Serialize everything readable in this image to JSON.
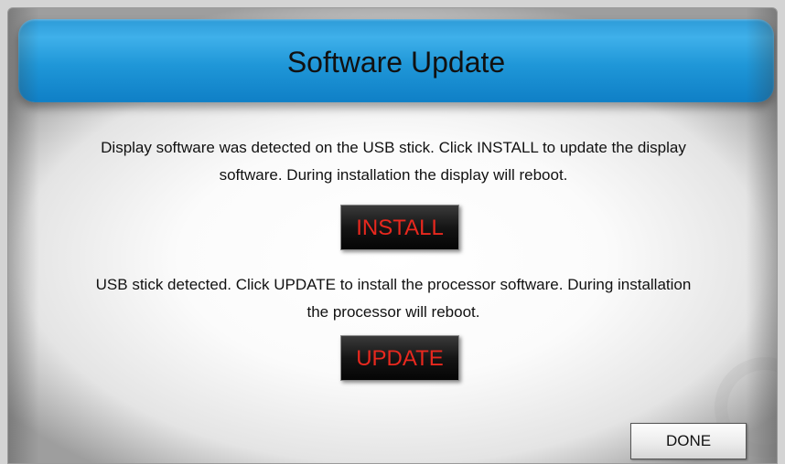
{
  "dialog": {
    "title": "Software Update",
    "display_message_line1": "Display software was detected on the USB stick.  Click INSTALL to update the display",
    "display_message_line2": "software.  During installation the display will reboot.",
    "install_label": "INSTALL",
    "usb_message_line1": "USB stick detected.  Click UPDATE to install the processor software.  During installation",
    "usb_message_line2": "the processor will reboot.",
    "update_label": "UPDATE",
    "done_label": "DONE"
  },
  "colors": {
    "title_bar": "#1f97d8",
    "action_text": "#e8281e",
    "action_button_bg": "#151515"
  }
}
